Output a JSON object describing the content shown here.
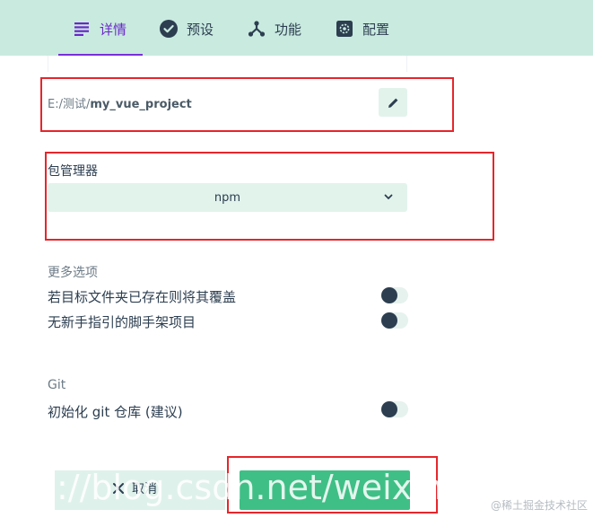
{
  "tabs": [
    {
      "label": "详情",
      "icon": "details-list-icon",
      "active": true
    },
    {
      "label": "预设",
      "icon": "check-circle-icon",
      "active": false
    },
    {
      "label": "功能",
      "icon": "features-branch-icon",
      "active": false
    },
    {
      "label": "配置",
      "icon": "gear-icon",
      "active": false
    }
  ],
  "path": {
    "prefix": "E:/测试/",
    "project": "my_vue_project",
    "edit_icon": "pencil-icon"
  },
  "package_manager": {
    "label": "包管理器",
    "value": "npm"
  },
  "more_options": {
    "title": "更多选项",
    "options": [
      {
        "label": "若目标文件夹已存在则将其覆盖",
        "enabled": false
      },
      {
        "label": "无新手指引的脚手架项目",
        "enabled": false
      }
    ]
  },
  "git": {
    "title": "Git",
    "init_label": "初始化 git 仓库 (建议)",
    "enabled": false
  },
  "actions": {
    "cancel_label": "取消"
  },
  "overlay": {
    "watermark_text": "://blog.csdn.net/weixin_",
    "corner_text": "@稀土掘金技术社区"
  },
  "colors": {
    "header_bg": "#c9eadf",
    "accent": "#7a2fd8",
    "primary_button": "#3fbf86",
    "annotation_red": "#e5262b"
  }
}
